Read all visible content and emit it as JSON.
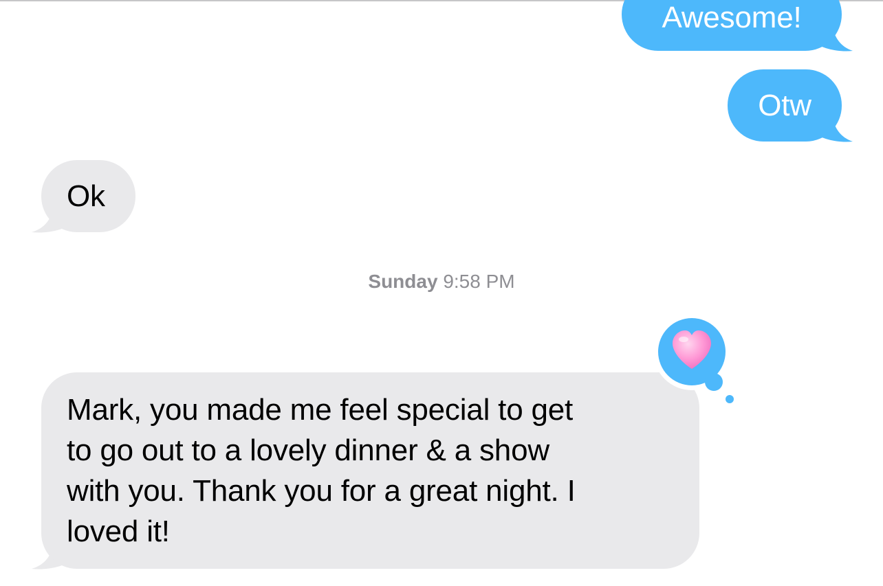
{
  "conversation": {
    "messages": [
      {
        "direction": "sent",
        "text": "Awesome!"
      },
      {
        "direction": "sent",
        "text": "Otw"
      },
      {
        "direction": "received",
        "text": "Ok"
      },
      {
        "direction": "received",
        "lines": [
          "Mark, you made me feel special to get",
          "to go out to a lovely dinner & a show",
          "with you. Thank you for a great night. I",
          "loved it!"
        ],
        "tapback": "heart-icon"
      }
    ],
    "timestamp": {
      "day": "Sunday",
      "time": "9:58 PM"
    }
  },
  "colors": {
    "sent_bubble": "#4db8fb",
    "received_bubble": "#e9e9eb",
    "timestamp_text": "#8e8e93",
    "heart": "#ff8fd0"
  }
}
